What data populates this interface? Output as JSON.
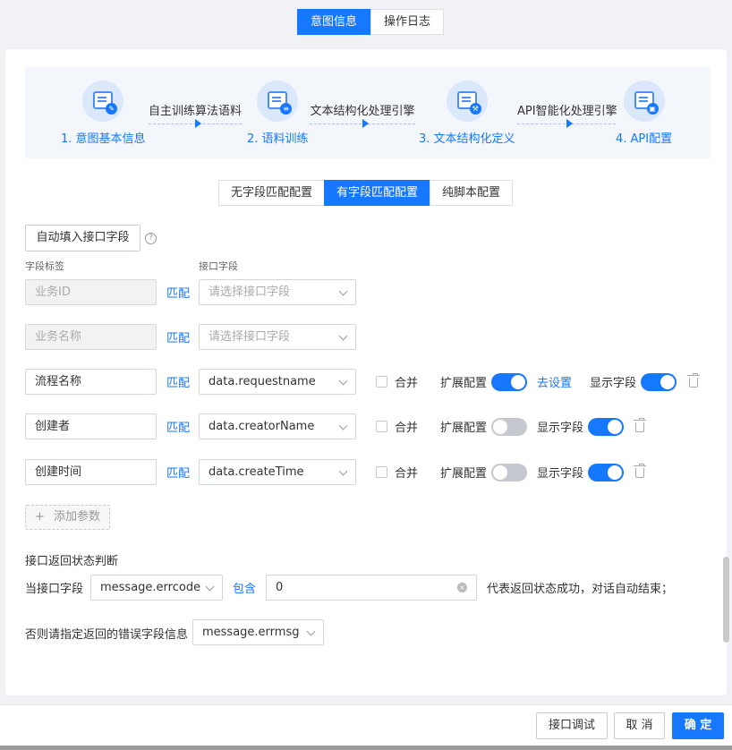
{
  "top_tabs": [
    "意图信息",
    "操作日志"
  ],
  "steps": [
    {
      "label": "1. 意图基本信息",
      "icon": "pen"
    },
    {
      "label": "2. 语料训练",
      "icon": "layers"
    },
    {
      "label": "3. 文本结构化定义",
      "icon": "tool"
    },
    {
      "label": "4. API配置",
      "icon": "api"
    }
  ],
  "connectors": [
    "自主训练算法语料",
    "文本结构化处理引擎",
    "API智能化处理引擎"
  ],
  "mode_tabs": [
    "无字段匹配配置",
    "有字段匹配配置",
    "纯脚本配置"
  ],
  "autofill_button": "自动填入接口字段",
  "help_glyph": "?",
  "columns": {
    "field_label": "字段标签",
    "api_field": "接口字段"
  },
  "match_label": "匹配",
  "select_placeholder": "请选择接口字段",
  "disabled_fields": [
    "业务ID",
    "业务名称"
  ],
  "rows": [
    {
      "label": "流程名称",
      "api_field": "data.requestname",
      "merge": "合并",
      "extend": "扩展配置",
      "extend_on": true,
      "goto": "去设置",
      "show": "显示字段",
      "show_on": true
    },
    {
      "label": "创建者",
      "api_field": "data.creatorName",
      "merge": "合并",
      "extend": "扩展配置",
      "extend_on": false,
      "show": "显示字段",
      "show_on": true
    },
    {
      "label": "创建时间",
      "api_field": "data.createTime",
      "merge": "合并",
      "extend": "扩展配置",
      "extend_on": false,
      "show": "显示字段",
      "show_on": true
    }
  ],
  "add_param": "添加参数",
  "add_glyph": "+",
  "status": {
    "section_title": "接口返回状态判断",
    "when_label": "当接口字段",
    "field": "message.errcode",
    "contains": "包含",
    "value": "0",
    "result_text": "代表返回状态成功，对话自动结束；",
    "else_label": "否则请指定返回的错误字段信息",
    "error_field": "message.errmsg",
    "clear_glyph": "×"
  },
  "footer": {
    "debug": "接口调试",
    "cancel": "取 消",
    "confirm": "确 定"
  },
  "colors": {
    "primary": "#1677ff",
    "switch_off": "#c5c8ce"
  }
}
